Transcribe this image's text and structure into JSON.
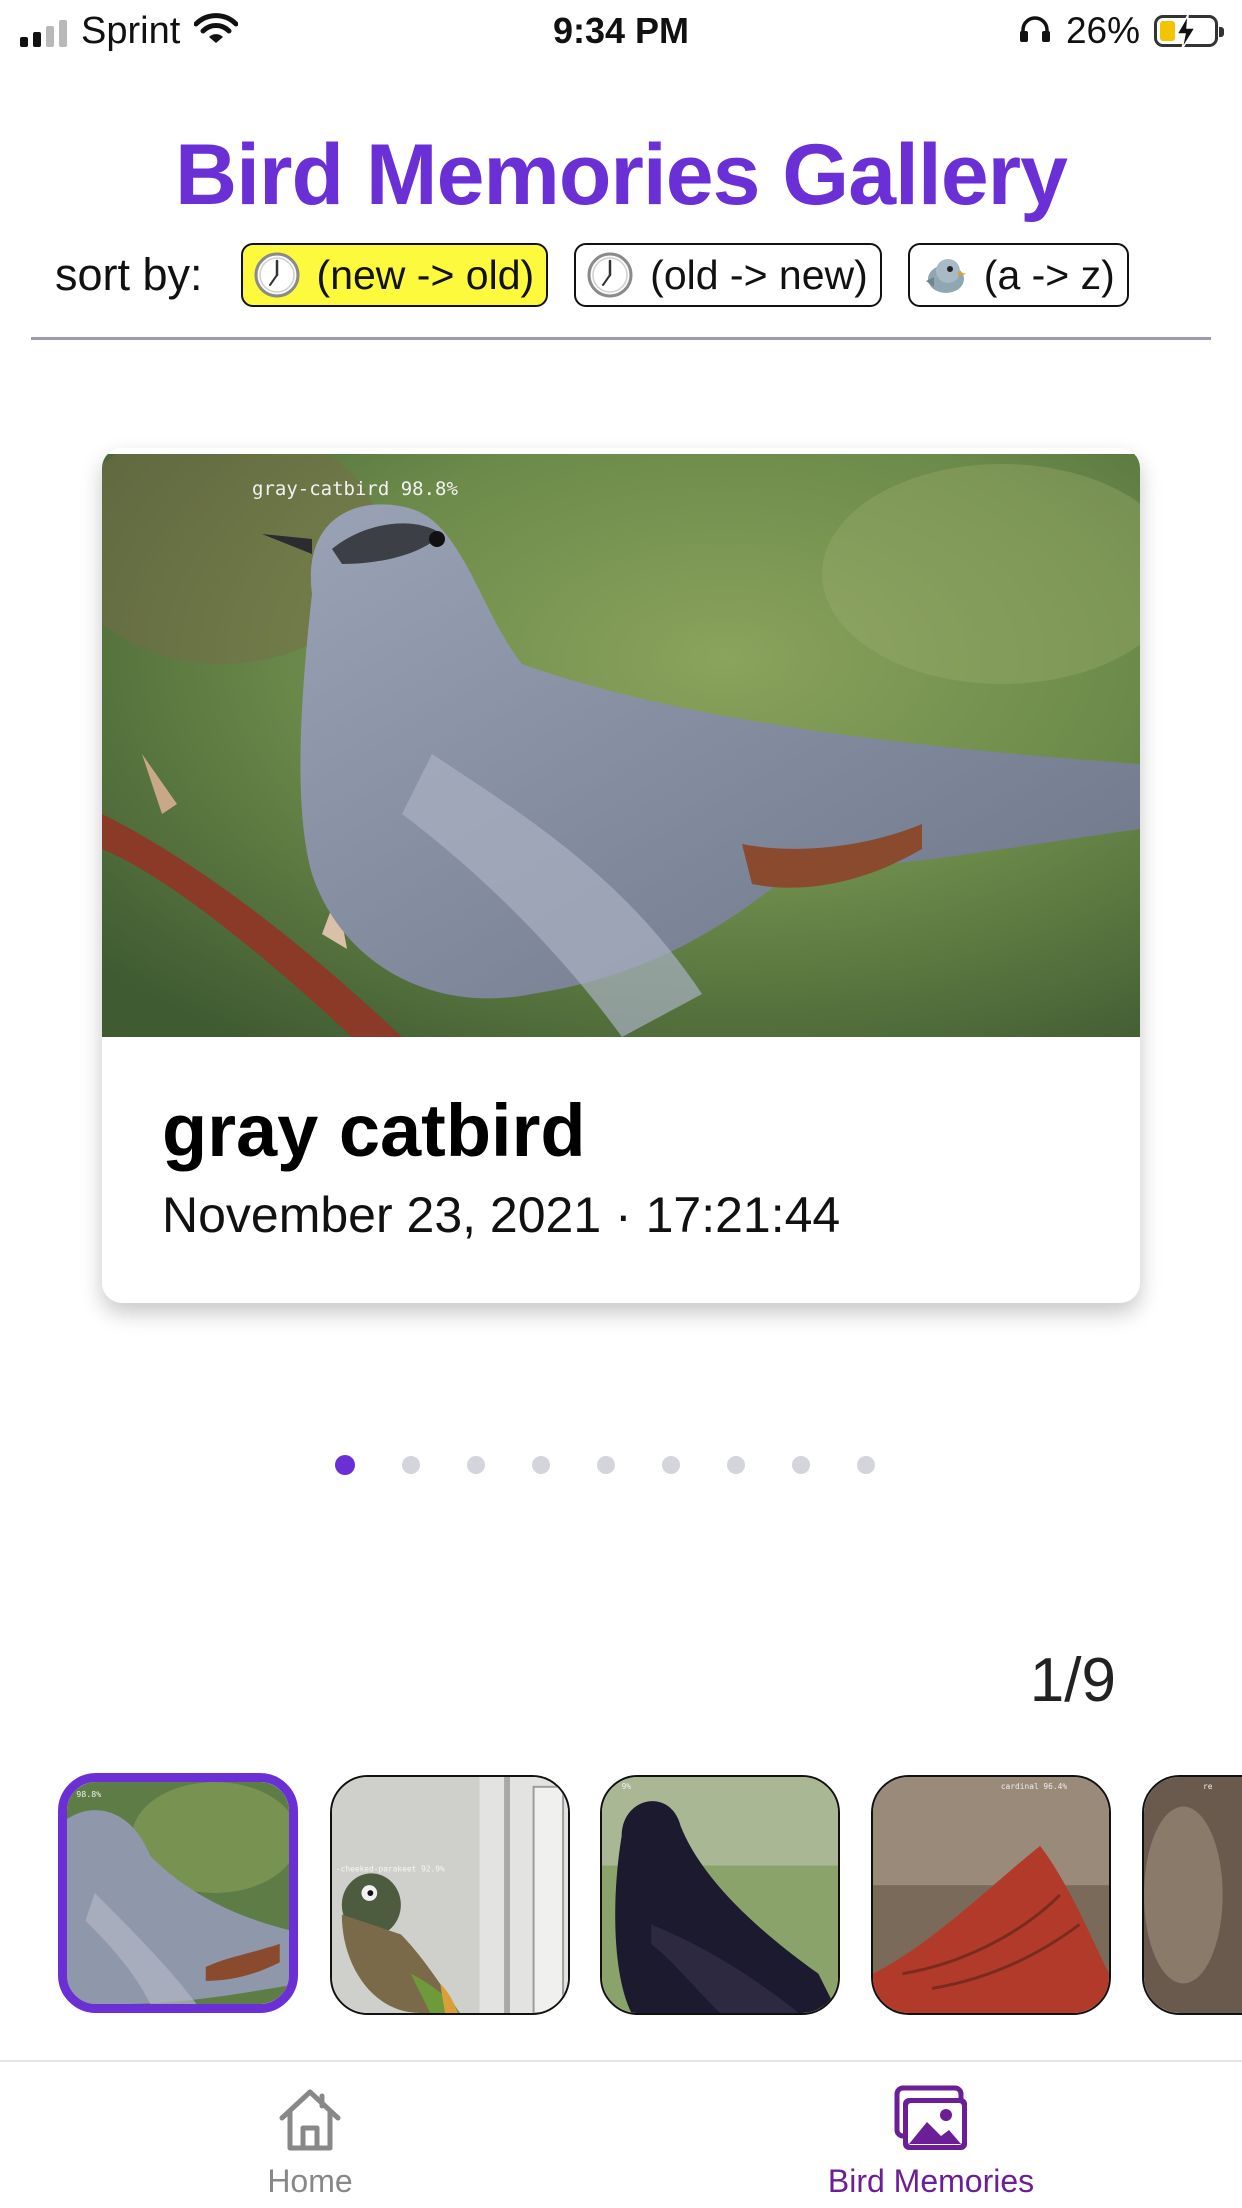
{
  "status_bar": {
    "carrier": "Sprint",
    "time": "9:34 PM",
    "battery_percent": "26%",
    "icons": [
      "signal-icon",
      "wifi-icon",
      "headphones-icon",
      "battery-charging-icon"
    ]
  },
  "header": {
    "title": "Bird Memories Gallery",
    "sort_label": "sort by:",
    "sort_options": [
      {
        "label": "(new -> old)",
        "icon": "clock-icon",
        "active": true
      },
      {
        "label": "(old -> new)",
        "icon": "clock-icon",
        "active": false
      },
      {
        "label": "(a -> z)",
        "icon": "bird-icon",
        "active": false
      }
    ]
  },
  "card": {
    "overlay_label": "gray-catbird 98.8%",
    "bird_name": "gray catbird",
    "date": "November 23, 2021 · 17:21:44"
  },
  "pagination": {
    "total": 9,
    "current": 1,
    "counter_text": "1/9"
  },
  "thumbnails": {
    "overlay_labels": [
      "98.8%",
      "-cheeked-parakeet 92.9%",
      "9%",
      "cardinal 96.4%",
      "re"
    ],
    "active_index": 0
  },
  "tab_bar": {
    "tabs": [
      {
        "label": "Home",
        "icon": "home-icon",
        "active": false
      },
      {
        "label": "Bird Memories",
        "icon": "gallery-icon",
        "active": true
      }
    ]
  },
  "colors": {
    "accent": "#6b2fd6",
    "tab_active": "#6c1e97",
    "sort_active_bg": "#fdf93c"
  }
}
